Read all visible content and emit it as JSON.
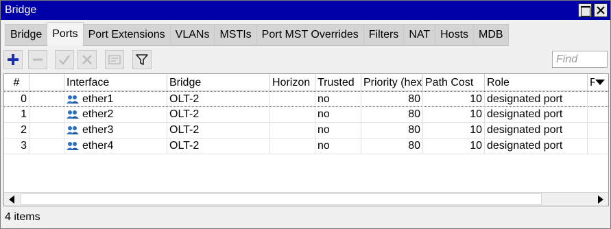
{
  "window": {
    "title": "Bridge"
  },
  "tabs": [
    {
      "label": "Bridge"
    },
    {
      "label": "Ports"
    },
    {
      "label": "Port Extensions"
    },
    {
      "label": "VLANs"
    },
    {
      "label": "MSTIs"
    },
    {
      "label": "Port MST Overrides"
    },
    {
      "label": "Filters"
    },
    {
      "label": "NAT"
    },
    {
      "label": "Hosts"
    },
    {
      "label": "MDB"
    }
  ],
  "active_tab": "Ports",
  "toolbar": {
    "find_placeholder": "Find",
    "icons": [
      "add-icon",
      "remove-icon",
      "enable-icon",
      "disable-icon",
      "comment-icon",
      "filter-icon"
    ]
  },
  "table": {
    "columns": [
      "#",
      "",
      "Interface",
      "Bridge",
      "Horizon",
      "Trusted",
      "Priority (hex)",
      "Path Cost",
      "Role",
      "R"
    ],
    "rows": [
      {
        "num": "0",
        "interface": "ether1",
        "bridge": "OLT-2",
        "horizon": "",
        "trusted": "no",
        "priority": "80",
        "path_cost": "10",
        "role": "designated port"
      },
      {
        "num": "1",
        "interface": "ether2",
        "bridge": "OLT-2",
        "horizon": "",
        "trusted": "no",
        "priority": "80",
        "path_cost": "10",
        "role": "designated port"
      },
      {
        "num": "2",
        "interface": "ether3",
        "bridge": "OLT-2",
        "horizon": "",
        "trusted": "no",
        "priority": "80",
        "path_cost": "10",
        "role": "designated port"
      },
      {
        "num": "3",
        "interface": "ether4",
        "bridge": "OLT-2",
        "horizon": "",
        "trusted": "no",
        "priority": "80",
        "path_cost": "10",
        "role": "designated port"
      }
    ]
  },
  "status": {
    "count": "4 items"
  },
  "colors": {
    "titlebar": "#0000a8",
    "add_icon": "#1a2fb0",
    "interface_icon": "#2a6fc0"
  }
}
